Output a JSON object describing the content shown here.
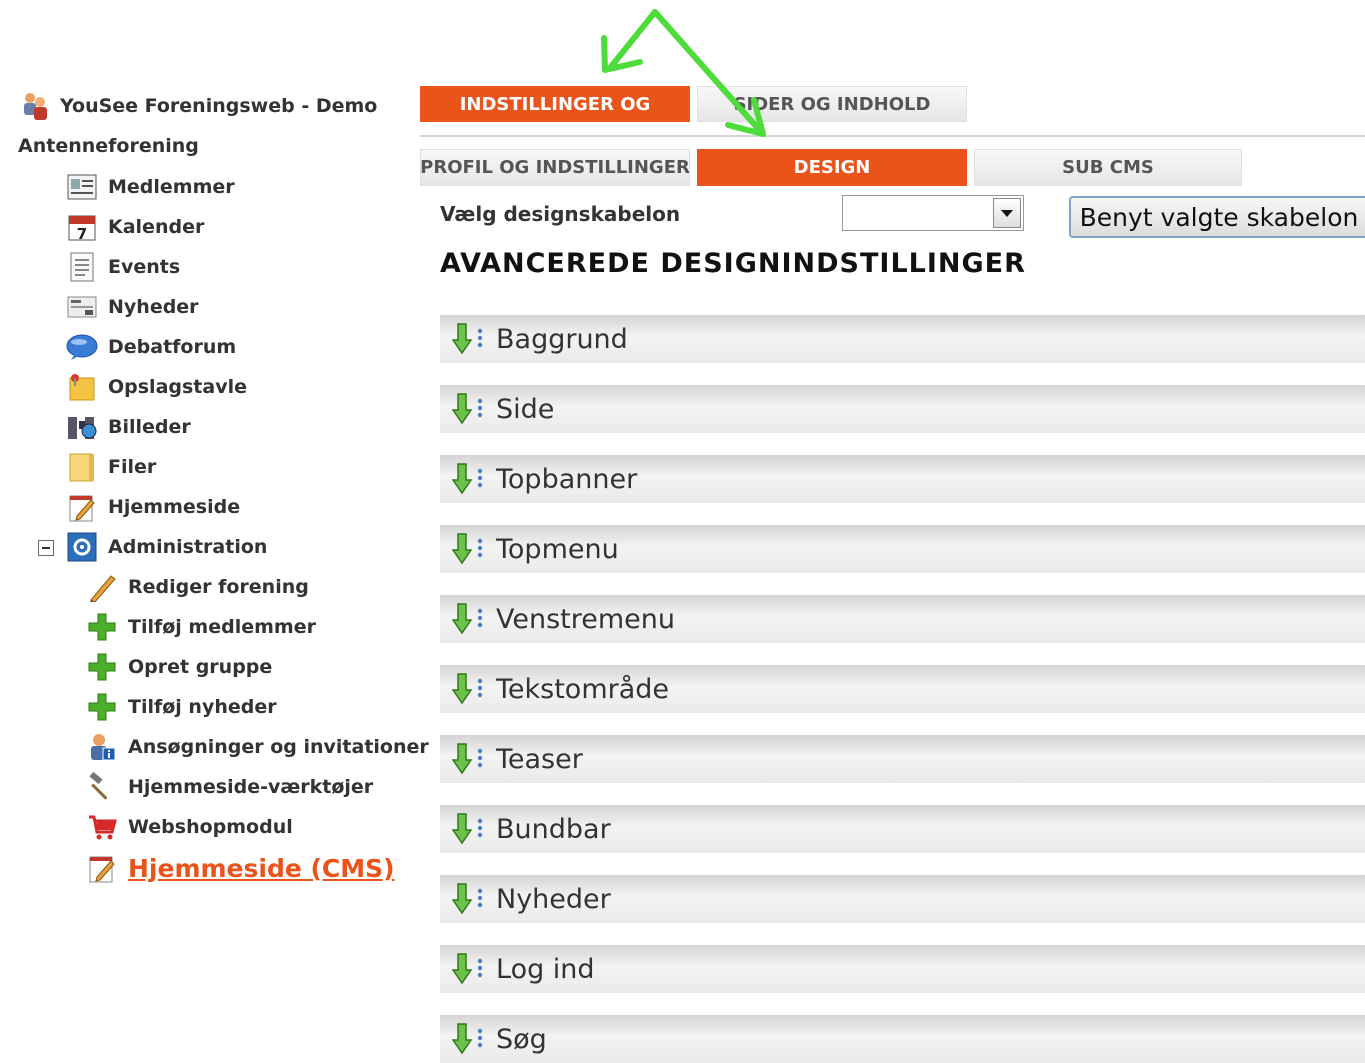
{
  "sidebar": {
    "org_line1": "YouSee Foreningsweb - Demo",
    "org_line2": "Antenneforening",
    "items": [
      {
        "label": "Medlemmer",
        "icon": "member-card-icon"
      },
      {
        "label": "Kalender",
        "icon": "calendar-icon"
      },
      {
        "label": "Events",
        "icon": "document-icon"
      },
      {
        "label": "Nyheder",
        "icon": "newspaper-icon"
      },
      {
        "label": "Debatforum",
        "icon": "speech-bubble-icon"
      },
      {
        "label": "Opslagstavle",
        "icon": "pinboard-icon"
      },
      {
        "label": "Billeder",
        "icon": "binoculars-icon"
      },
      {
        "label": "Filer",
        "icon": "folder-icon"
      },
      {
        "label": "Hjemmeside",
        "icon": "page-edit-icon"
      },
      {
        "label": "Administration",
        "icon": "admin-gear-icon"
      }
    ],
    "admin_items": [
      {
        "label": "Rediger forening",
        "icon": "pencil-icon"
      },
      {
        "label": "Tilføj medlemmer",
        "icon": "plus-icon"
      },
      {
        "label": "Opret gruppe",
        "icon": "plus-icon"
      },
      {
        "label": "Tilføj nyheder",
        "icon": "plus-icon"
      },
      {
        "label": "Ansøgninger og invitationer",
        "icon": "user-info-icon"
      },
      {
        "label": "Hjemmeside-værktøjer",
        "icon": "hammer-icon"
      },
      {
        "label": "Webshopmodul",
        "icon": "cart-icon"
      },
      {
        "label": "Hjemmeside (CMS)",
        "icon": "page-edit-icon"
      }
    ]
  },
  "top_tabs": {
    "tab1": "INDSTILLINGER OG",
    "tab2": "SIDER OG INDHOLD"
  },
  "sub_tabs": {
    "tab1": "PROFIL OG INDSTILLINGER",
    "tab2": "DESIGN",
    "tab3": "SUB CMS"
  },
  "template": {
    "label": "Vælg designskabelon",
    "selected": "",
    "apply_button": "Benyt valgte skabelon"
  },
  "advanced_heading": "AVANCEREDE DESIGNINDSTILLINGER",
  "sections": [
    "Baggrund",
    "Side",
    "Topbanner",
    "Topmenu",
    "Venstremenu",
    "Tekstområde",
    "Teaser",
    "Bundbar",
    "Nyheder",
    "Log ind",
    "Søg"
  ],
  "colors": {
    "accent": "#e8541a",
    "arrow": "#4ddc3a",
    "active_link": "#e8541a"
  }
}
